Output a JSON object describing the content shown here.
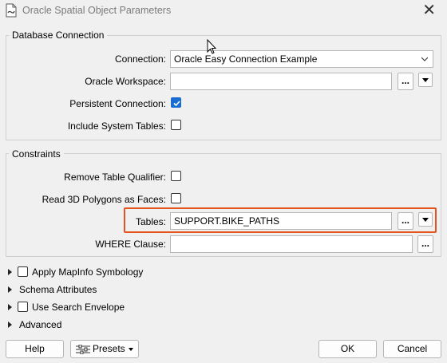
{
  "window": {
    "title": "Oracle Spatial Object Parameters",
    "close_glyph": "✕"
  },
  "database_connection": {
    "title": "Database Connection",
    "connection_label": "Connection:",
    "connection_value": "Oracle Easy Connection Example",
    "workspace_label": "Oracle Workspace:",
    "workspace_value": "",
    "persistent_label": "Persistent Connection:",
    "persistent_checked": true,
    "system_tables_label": "Include System Tables:",
    "system_tables_checked": false
  },
  "constraints": {
    "title": "Constraints",
    "remove_qualifier_label": "Remove Table Qualifier:",
    "read3d_label": "Read 3D Polygons as Faces:",
    "tables_label": "Tables:",
    "tables_value": "SUPPORT.BIKE_PATHS",
    "where_label": "WHERE Clause:",
    "where_value": ""
  },
  "sections": {
    "mapinfo": "Apply MapInfo Symbology",
    "schema": "Schema Attributes",
    "search_envelope": "Use Search Envelope",
    "advanced": "Advanced"
  },
  "buttons": {
    "ellipsis": "...",
    "help": "Help",
    "presets": "Presets",
    "ok": "OK",
    "cancel": "Cancel"
  },
  "colors": {
    "accent": "#1a6dd0",
    "highlight": "#e4541e"
  }
}
